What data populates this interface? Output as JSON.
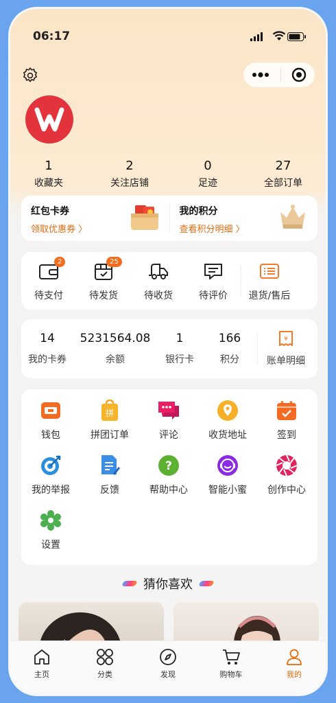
{
  "status": {
    "time": "06:17"
  },
  "stats": [
    {
      "num": "1",
      "label": "收藏夹"
    },
    {
      "num": "2",
      "label": "关注店铺"
    },
    {
      "num": "0",
      "label": "足迹"
    },
    {
      "num": "27",
      "label": "全部订单"
    }
  ],
  "coupons": {
    "left_title": "红包卡券",
    "left_link": "领取优惠券 〉",
    "right_title": "我的积分",
    "right_link": "查看积分明细 〉"
  },
  "orders": [
    {
      "label": "待支付",
      "badge": "2",
      "icon": "wallet-icon"
    },
    {
      "label": "待发货",
      "badge": "25",
      "icon": "package-icon"
    },
    {
      "label": "待收货",
      "badge": "",
      "icon": "truck-icon"
    },
    {
      "label": "待评价",
      "badge": "",
      "icon": "comment-icon"
    },
    {
      "label": "退货/售后",
      "badge": "",
      "icon": "return-icon"
    }
  ],
  "wallet": [
    {
      "num": "14",
      "label": "我的卡券"
    },
    {
      "num": "5231564.08",
      "label": "余额"
    },
    {
      "num": "1",
      "label": "银行卡"
    },
    {
      "num": "166",
      "label": "积分"
    }
  ],
  "wallet_bill": {
    "label": "账单明细",
    "icon": "bill-icon"
  },
  "services": [
    {
      "label": "钱包",
      "icon": "wallet-app-icon"
    },
    {
      "label": "拼团订单",
      "icon": "group-order-icon"
    },
    {
      "label": "评论",
      "icon": "review-icon"
    },
    {
      "label": "收货地址",
      "icon": "location-icon"
    },
    {
      "label": "签到",
      "icon": "checkin-icon"
    },
    {
      "label": "我的举报",
      "icon": "report-icon"
    },
    {
      "label": "反馈",
      "icon": "feedback-icon"
    },
    {
      "label": "帮助中心",
      "icon": "help-icon"
    },
    {
      "label": "智能小蜜",
      "icon": "assistant-icon"
    },
    {
      "label": "创作中心",
      "icon": "creator-icon"
    },
    {
      "label": "设置",
      "icon": "settings-icon"
    }
  ],
  "guess_title": "猜你喜欢",
  "tabs": [
    {
      "label": "主页",
      "icon": "home-icon"
    },
    {
      "label": "分类",
      "icon": "category-icon"
    },
    {
      "label": "发现",
      "icon": "compass-icon"
    },
    {
      "label": "购物车",
      "icon": "cart-icon"
    },
    {
      "label": "我的",
      "icon": "profile-icon"
    }
  ],
  "colors": {
    "accent": "#e46b0e",
    "badge": "#f36b1c",
    "brand_red": "#e3333c"
  }
}
